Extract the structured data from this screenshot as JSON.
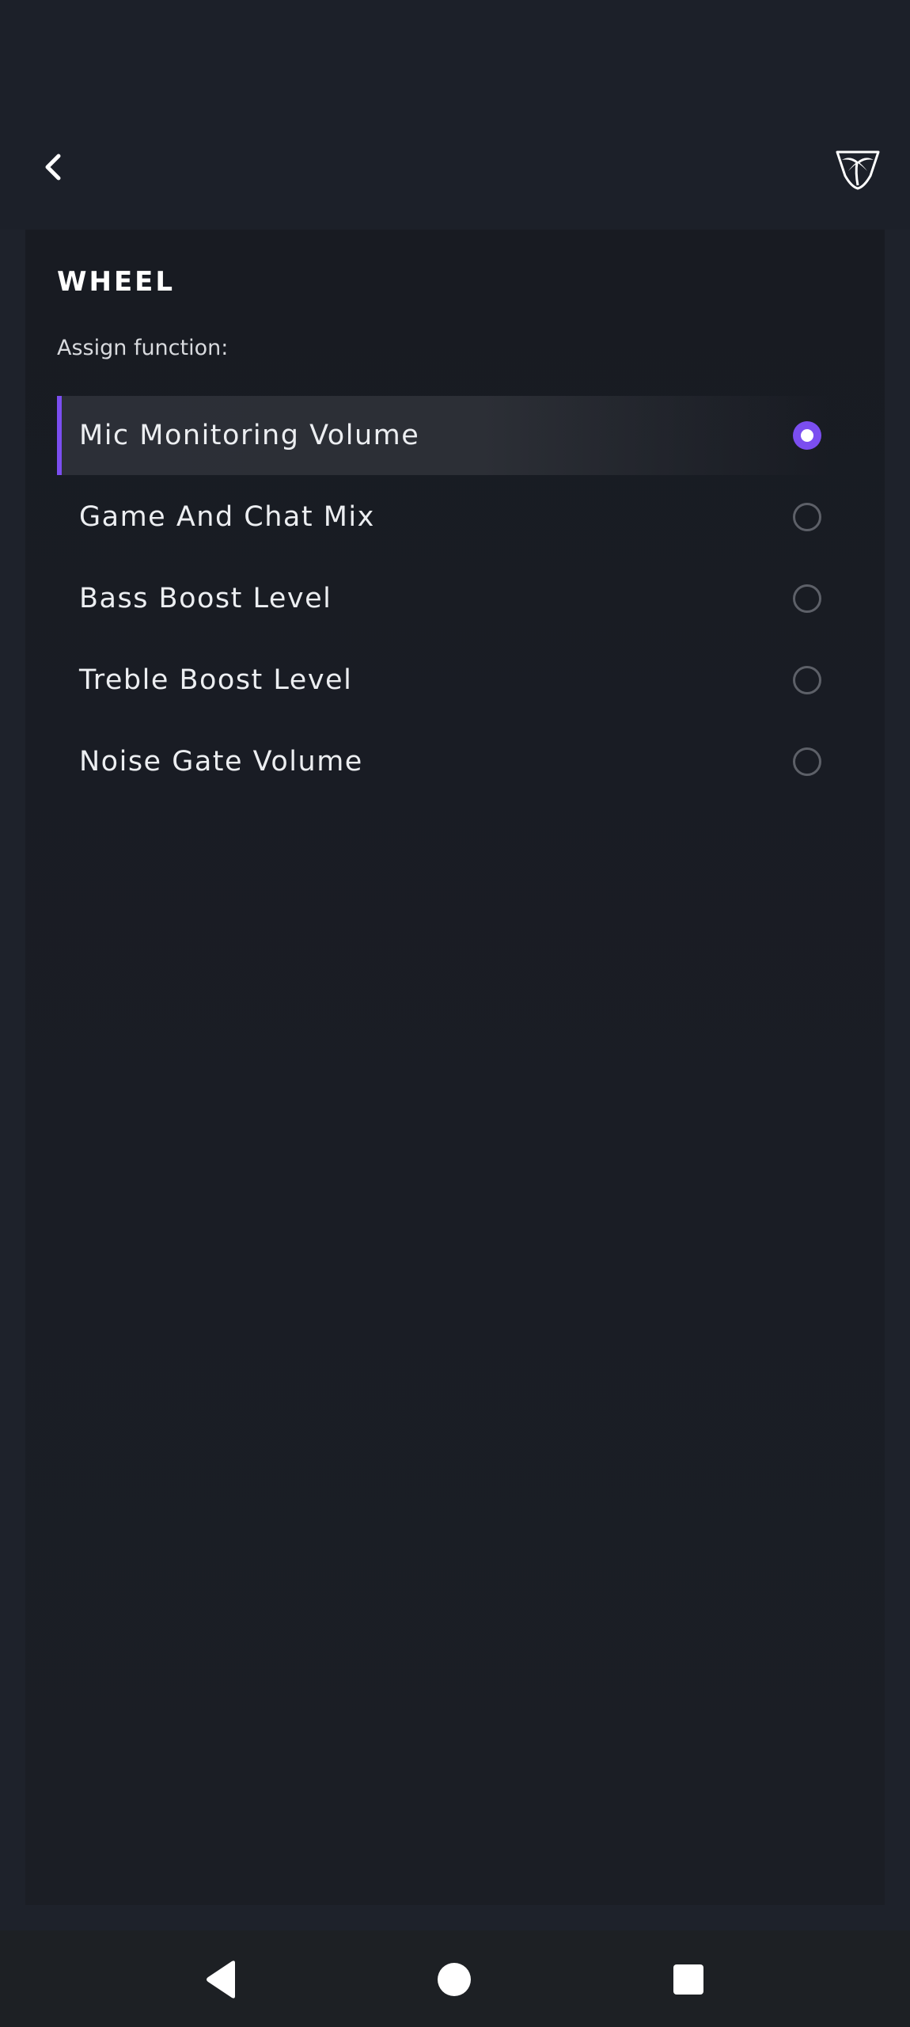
{
  "header": {
    "back_icon": "chevron-left-icon",
    "logo_icon": "palm-tree-shield-logo"
  },
  "panel": {
    "title": "WHEEL",
    "assign_label": "Assign function:",
    "options": [
      {
        "label": "Mic Monitoring Volume",
        "selected": true
      },
      {
        "label": "Game And Chat Mix",
        "selected": false
      },
      {
        "label": "Bass Boost Level",
        "selected": false
      },
      {
        "label": "Treble Boost Level",
        "selected": false
      },
      {
        "label": "Noise Gate Volume",
        "selected": false
      }
    ]
  },
  "colors": {
    "accent": "#7b4ef0",
    "background": "#1e222b",
    "panel": "#1a1d25"
  },
  "navigation": {
    "back_icon": "triangle-back-icon",
    "home_icon": "circle-home-icon",
    "recents_icon": "square-recents-icon"
  }
}
